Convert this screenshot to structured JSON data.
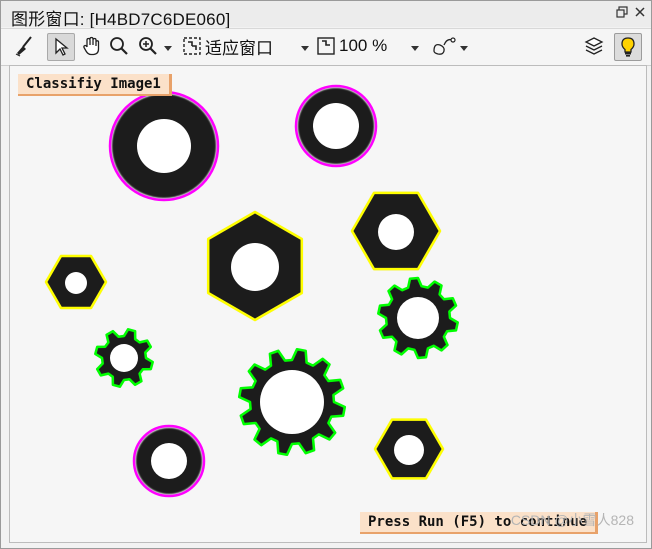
{
  "window": {
    "title": "图形窗口: [H4BD7C6DE060]"
  },
  "toolbar": {
    "fit_label": "适应窗口",
    "zoom_label": "100 %"
  },
  "canvas": {
    "top_label": "Classifiy Image1",
    "bottom_label": "Press Run (F5) to continue",
    "watermark": "CSDN @小雪人828"
  },
  "colors": {
    "washer_outline": "#ff00ff",
    "nut_outline": "#ffff00",
    "gear_outline": "#00ff00",
    "label_fill": "#fbe1c9",
    "label_border": "#e8a26a"
  }
}
